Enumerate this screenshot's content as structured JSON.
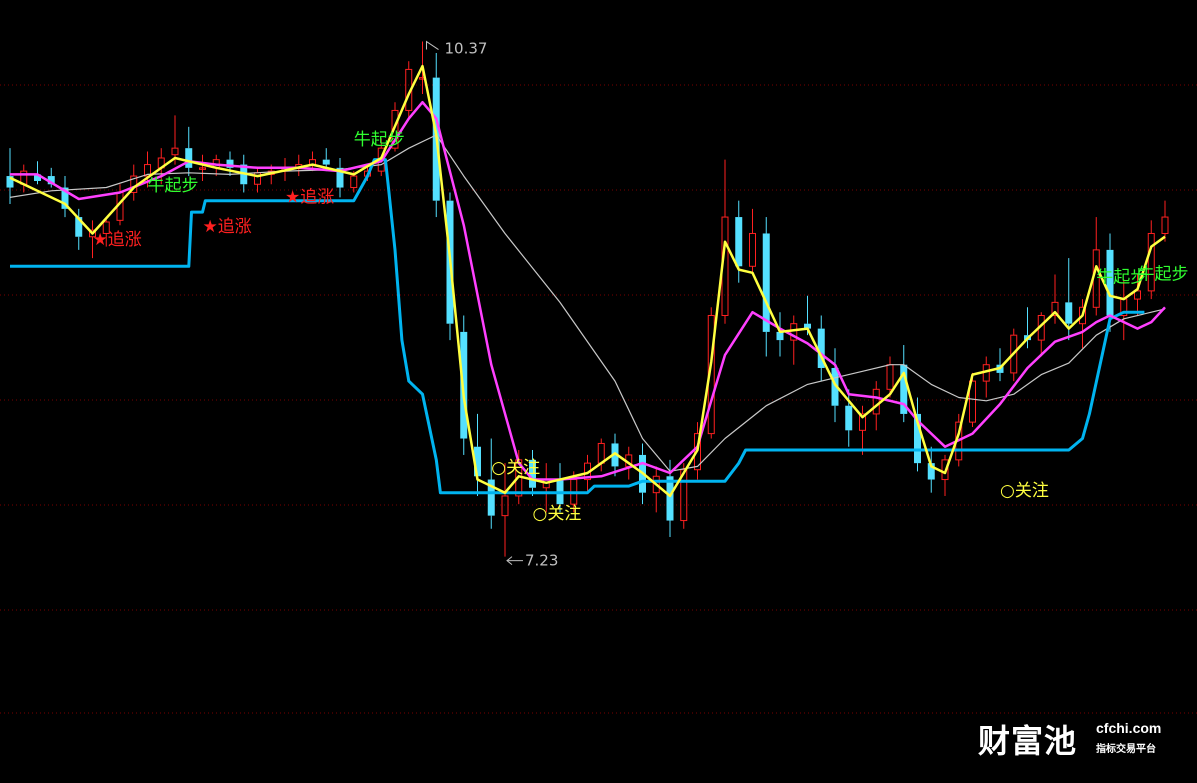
{
  "chart_data": {
    "type": "candlestick",
    "y_range": [
      6.6,
      10.55
    ],
    "grid": "dotted-horizontal",
    "colors": {
      "up": "#ff2020",
      "down": "#54e0ff",
      "fast_line": "#ffff40",
      "mid_line": "#ff40ff",
      "slow_line": "#c8c8c8",
      "support_line": "#00b4f0",
      "grid": "#7a0000",
      "signal_buy": "#30ff30",
      "signal_chase": "#ff2020",
      "signal_watch": "#ffff40",
      "extreme": "#c0c0c0"
    },
    "price_labels": {
      "high": "10.37",
      "low": "7.23"
    },
    "candles": [
      [
        9.55,
        9.72,
        9.38,
        9.48
      ],
      [
        9.5,
        9.62,
        9.45,
        9.58
      ],
      [
        9.56,
        9.64,
        9.5,
        9.52
      ],
      [
        9.55,
        9.6,
        9.48,
        9.5
      ],
      [
        9.48,
        9.55,
        9.3,
        9.35
      ],
      [
        9.3,
        9.35,
        9.1,
        9.18
      ],
      [
        9.18,
        9.28,
        9.05,
        9.22
      ],
      [
        9.2,
        9.3,
        9.12,
        9.27
      ],
      [
        9.28,
        9.5,
        9.25,
        9.45
      ],
      [
        9.45,
        9.62,
        9.4,
        9.55
      ],
      [
        9.55,
        9.7,
        9.48,
        9.62
      ],
      [
        9.6,
        9.72,
        9.5,
        9.66
      ],
      [
        9.68,
        9.92,
        9.62,
        9.72
      ],
      [
        9.72,
        9.85,
        9.55,
        9.6
      ],
      [
        9.6,
        9.68,
        9.52,
        9.6
      ],
      [
        9.6,
        9.68,
        9.55,
        9.65
      ],
      [
        9.65,
        9.7,
        9.55,
        9.6
      ],
      [
        9.62,
        9.68,
        9.45,
        9.5
      ],
      [
        9.5,
        9.6,
        9.45,
        9.57
      ],
      [
        9.56,
        9.62,
        9.5,
        9.58
      ],
      [
        9.58,
        9.66,
        9.52,
        9.6
      ],
      [
        9.6,
        9.68,
        9.55,
        9.62
      ],
      [
        9.62,
        9.7,
        9.58,
        9.65
      ],
      [
        9.65,
        9.72,
        9.58,
        9.62
      ],
      [
        9.6,
        9.66,
        9.42,
        9.48
      ],
      [
        9.48,
        9.58,
        9.45,
        9.55
      ],
      [
        9.55,
        9.62,
        9.52,
        9.58
      ],
      [
        9.58,
        9.78,
        9.55,
        9.72
      ],
      [
        9.72,
        10.0,
        9.7,
        9.95
      ],
      [
        9.95,
        10.25,
        9.9,
        10.2
      ],
      [
        10.15,
        10.37,
        10.05,
        10.15
      ],
      [
        10.15,
        10.3,
        9.3,
        9.4
      ],
      [
        9.4,
        9.45,
        8.55,
        8.65
      ],
      [
        8.6,
        8.7,
        7.85,
        7.95
      ],
      [
        7.9,
        8.1,
        7.6,
        7.72
      ],
      [
        7.7,
        7.95,
        7.4,
        7.48
      ],
      [
        7.48,
        7.8,
        7.23,
        7.6
      ],
      [
        7.6,
        7.88,
        7.55,
        7.82
      ],
      [
        7.82,
        7.88,
        7.6,
        7.65
      ],
      [
        7.65,
        7.8,
        7.5,
        7.7
      ],
      [
        7.7,
        7.8,
        7.5,
        7.55
      ],
      [
        7.55,
        7.75,
        7.5,
        7.7
      ],
      [
        7.7,
        7.85,
        7.62,
        7.8
      ],
      [
        7.8,
        7.95,
        7.75,
        7.92
      ],
      [
        7.92,
        7.98,
        7.72,
        7.78
      ],
      [
        7.78,
        7.9,
        7.7,
        7.85
      ],
      [
        7.85,
        7.92,
        7.55,
        7.62
      ],
      [
        7.62,
        7.78,
        7.5,
        7.72
      ],
      [
        7.72,
        7.82,
        7.35,
        7.45
      ],
      [
        7.45,
        7.8,
        7.4,
        7.76
      ],
      [
        7.76,
        8.05,
        7.7,
        7.98
      ],
      [
        7.98,
        8.75,
        7.95,
        8.7
      ],
      [
        8.7,
        9.65,
        8.65,
        9.3
      ],
      [
        9.3,
        9.4,
        8.9,
        9.0
      ],
      [
        9.0,
        9.35,
        8.95,
        9.2
      ],
      [
        9.2,
        9.3,
        8.45,
        8.6
      ],
      [
        8.6,
        8.72,
        8.45,
        8.55
      ],
      [
        8.55,
        8.7,
        8.4,
        8.65
      ],
      [
        8.65,
        8.82,
        8.58,
        8.62
      ],
      [
        8.62,
        8.7,
        8.3,
        8.38
      ],
      [
        8.38,
        8.5,
        8.05,
        8.15
      ],
      [
        8.15,
        8.25,
        7.9,
        8.0
      ],
      [
        8.0,
        8.15,
        7.85,
        8.1
      ],
      [
        8.1,
        8.3,
        8.0,
        8.25
      ],
      [
        8.25,
        8.45,
        8.2,
        8.4
      ],
      [
        8.4,
        8.52,
        8.05,
        8.1
      ],
      [
        8.1,
        8.2,
        7.75,
        7.8
      ],
      [
        7.8,
        7.9,
        7.62,
        7.7
      ],
      [
        7.7,
        7.85,
        7.6,
        7.82
      ],
      [
        7.82,
        8.1,
        7.78,
        8.05
      ],
      [
        8.05,
        8.35,
        8.02,
        8.3
      ],
      [
        8.3,
        8.45,
        8.2,
        8.4
      ],
      [
        8.4,
        8.5,
        8.3,
        8.35
      ],
      [
        8.35,
        8.62,
        8.3,
        8.58
      ],
      [
        8.58,
        8.75,
        8.5,
        8.55
      ],
      [
        8.55,
        8.72,
        8.45,
        8.7
      ],
      [
        8.7,
        8.95,
        8.65,
        8.78
      ],
      [
        8.78,
        9.05,
        8.55,
        8.65
      ],
      [
        8.65,
        8.8,
        8.5,
        8.75
      ],
      [
        8.75,
        9.3,
        8.7,
        9.1
      ],
      [
        9.1,
        9.2,
        8.6,
        8.7
      ],
      [
        8.7,
        8.92,
        8.55,
        8.8
      ],
      [
        8.8,
        8.95,
        8.7,
        8.85
      ],
      [
        8.85,
        9.28,
        8.8,
        9.2
      ],
      [
        9.2,
        9.4,
        9.15,
        9.3
      ]
    ],
    "lines": {
      "fast": [
        [
          0,
          9.54
        ],
        [
          4,
          9.38
        ],
        [
          6,
          9.2
        ],
        [
          9,
          9.48
        ],
        [
          12,
          9.66
        ],
        [
          15,
          9.6
        ],
        [
          18,
          9.55
        ],
        [
          22,
          9.62
        ],
        [
          25,
          9.56
        ],
        [
          27,
          9.66
        ],
        [
          29,
          10.05
        ],
        [
          30,
          10.22
        ],
        [
          31,
          9.8
        ],
        [
          32,
          9.05
        ],
        [
          33,
          8.2
        ],
        [
          34,
          7.7
        ],
        [
          36,
          7.62
        ],
        [
          37,
          7.72
        ],
        [
          39,
          7.68
        ],
        [
          42,
          7.74
        ],
        [
          44,
          7.86
        ],
        [
          46,
          7.74
        ],
        [
          48,
          7.6
        ],
        [
          50,
          7.88
        ],
        [
          51,
          8.42
        ],
        [
          52,
          9.15
        ],
        [
          53,
          8.98
        ],
        [
          54,
          8.96
        ],
        [
          56,
          8.6
        ],
        [
          58,
          8.62
        ],
        [
          60,
          8.28
        ],
        [
          62,
          8.08
        ],
        [
          64,
          8.22
        ],
        [
          65,
          8.35
        ],
        [
          66,
          8.05
        ],
        [
          67,
          7.78
        ],
        [
          68,
          7.74
        ],
        [
          69,
          7.98
        ],
        [
          70,
          8.34
        ],
        [
          72,
          8.38
        ],
        [
          74,
          8.56
        ],
        [
          76,
          8.72
        ],
        [
          77,
          8.62
        ],
        [
          78,
          8.7
        ],
        [
          79,
          9.0
        ],
        [
          80,
          8.82
        ],
        [
          81,
          8.8
        ],
        [
          82,
          8.86
        ],
        [
          83,
          9.12
        ],
        [
          84,
          9.18
        ]
      ],
      "mid": [
        [
          0,
          9.56
        ],
        [
          2,
          9.56
        ],
        [
          5,
          9.41
        ],
        [
          8,
          9.45
        ],
        [
          11,
          9.55
        ],
        [
          13,
          9.64
        ],
        [
          15,
          9.62
        ],
        [
          18,
          9.6
        ],
        [
          21,
          9.6
        ],
        [
          24,
          9.58
        ],
        [
          27,
          9.64
        ],
        [
          29,
          9.9
        ],
        [
          30,
          10.0
        ],
        [
          31,
          9.9
        ],
        [
          33,
          9.25
        ],
        [
          35,
          8.4
        ],
        [
          37,
          7.8
        ],
        [
          38,
          7.7
        ],
        [
          40,
          7.7
        ],
        [
          43,
          7.72
        ],
        [
          46,
          7.8
        ],
        [
          48,
          7.74
        ],
        [
          50,
          7.9
        ],
        [
          52,
          8.46
        ],
        [
          54,
          8.72
        ],
        [
          56,
          8.62
        ],
        [
          58,
          8.53
        ],
        [
          60,
          8.4
        ],
        [
          61,
          8.22
        ],
        [
          63,
          8.2
        ],
        [
          65,
          8.16
        ],
        [
          66,
          8.06
        ],
        [
          68,
          7.9
        ],
        [
          70,
          7.98
        ],
        [
          72,
          8.16
        ],
        [
          74,
          8.38
        ],
        [
          76,
          8.54
        ],
        [
          78,
          8.6
        ],
        [
          79,
          8.66
        ],
        [
          80,
          8.7
        ],
        [
          82,
          8.62
        ],
        [
          83,
          8.66
        ],
        [
          84,
          8.75
        ]
      ],
      "slow": [
        [
          0,
          9.42
        ],
        [
          3,
          9.46
        ],
        [
          7,
          9.48
        ],
        [
          10,
          9.56
        ],
        [
          13,
          9.57
        ],
        [
          16,
          9.56
        ],
        [
          20,
          9.58
        ],
        [
          24,
          9.59
        ],
        [
          27,
          9.62
        ],
        [
          29,
          9.72
        ],
        [
          31,
          9.8
        ],
        [
          33,
          9.55
        ],
        [
          36,
          9.2
        ],
        [
          40,
          8.78
        ],
        [
          44,
          8.3
        ],
        [
          46,
          7.95
        ],
        [
          48,
          7.75
        ],
        [
          50,
          7.78
        ],
        [
          52,
          7.95
        ],
        [
          55,
          8.15
        ],
        [
          58,
          8.28
        ],
        [
          60,
          8.32
        ],
        [
          62,
          8.36
        ],
        [
          64,
          8.4
        ],
        [
          65,
          8.4
        ],
        [
          67,
          8.28
        ],
        [
          69,
          8.2
        ],
        [
          71,
          8.18
        ],
        [
          73,
          8.22
        ],
        [
          75,
          8.34
        ],
        [
          77,
          8.41
        ],
        [
          79,
          8.58
        ],
        [
          81,
          8.68
        ],
        [
          83,
          8.72
        ],
        [
          84,
          8.74
        ]
      ],
      "support": [
        [
          0,
          9.0
        ],
        [
          12,
          9.0
        ],
        [
          13,
          9.0
        ],
        [
          13.2,
          9.33
        ],
        [
          14,
          9.33
        ],
        [
          14.2,
          9.4
        ],
        [
          25,
          9.4
        ],
        [
          26,
          9.55
        ],
        [
          26.5,
          9.65
        ],
        [
          27.3,
          9.65
        ],
        [
          27.5,
          9.5
        ],
        [
          28,
          9.1
        ],
        [
          28.5,
          8.55
        ],
        [
          29,
          8.3
        ],
        [
          30,
          8.22
        ],
        [
          31,
          7.82
        ],
        [
          31.3,
          7.62
        ],
        [
          42,
          7.62
        ],
        [
          42.5,
          7.66
        ],
        [
          45,
          7.66
        ],
        [
          46,
          7.69
        ],
        [
          52,
          7.69
        ],
        [
          53,
          7.8
        ],
        [
          53.5,
          7.88
        ],
        [
          77,
          7.88
        ],
        [
          78,
          7.95
        ],
        [
          78.5,
          8.1
        ],
        [
          80,
          8.68
        ],
        [
          81,
          8.72
        ],
        [
          82.5,
          8.72
        ]
      ]
    },
    "signals": [
      {
        "index": 10,
        "y": 9.46,
        "type": "buy",
        "text": "牛起步"
      },
      {
        "index": 25,
        "y": 9.74,
        "type": "buy",
        "text": "牛起步"
      },
      {
        "index": 79,
        "y": 8.9,
        "type": "buy",
        "text": "牛起步"
      },
      {
        "index": 82,
        "y": 8.92,
        "type": "buy",
        "text": "牛起步"
      },
      {
        "index": 6,
        "y": 9.13,
        "type": "chase",
        "text": "★追涨"
      },
      {
        "index": 14,
        "y": 9.21,
        "type": "chase",
        "text": "★追涨"
      },
      {
        "index": 20,
        "y": 9.39,
        "type": "chase",
        "text": "★追涨"
      },
      {
        "index": 35,
        "y": 7.74,
        "type": "watch",
        "text": "○关注"
      },
      {
        "index": 38,
        "y": 7.46,
        "type": "watch",
        "text": "○关注"
      },
      {
        "index": 72,
        "y": 7.6,
        "type": "watch",
        "text": "○关注"
      }
    ]
  },
  "watermark": {
    "brand": "财富池",
    "url": "cfchi.com",
    "tagline": "指标交易平台"
  }
}
